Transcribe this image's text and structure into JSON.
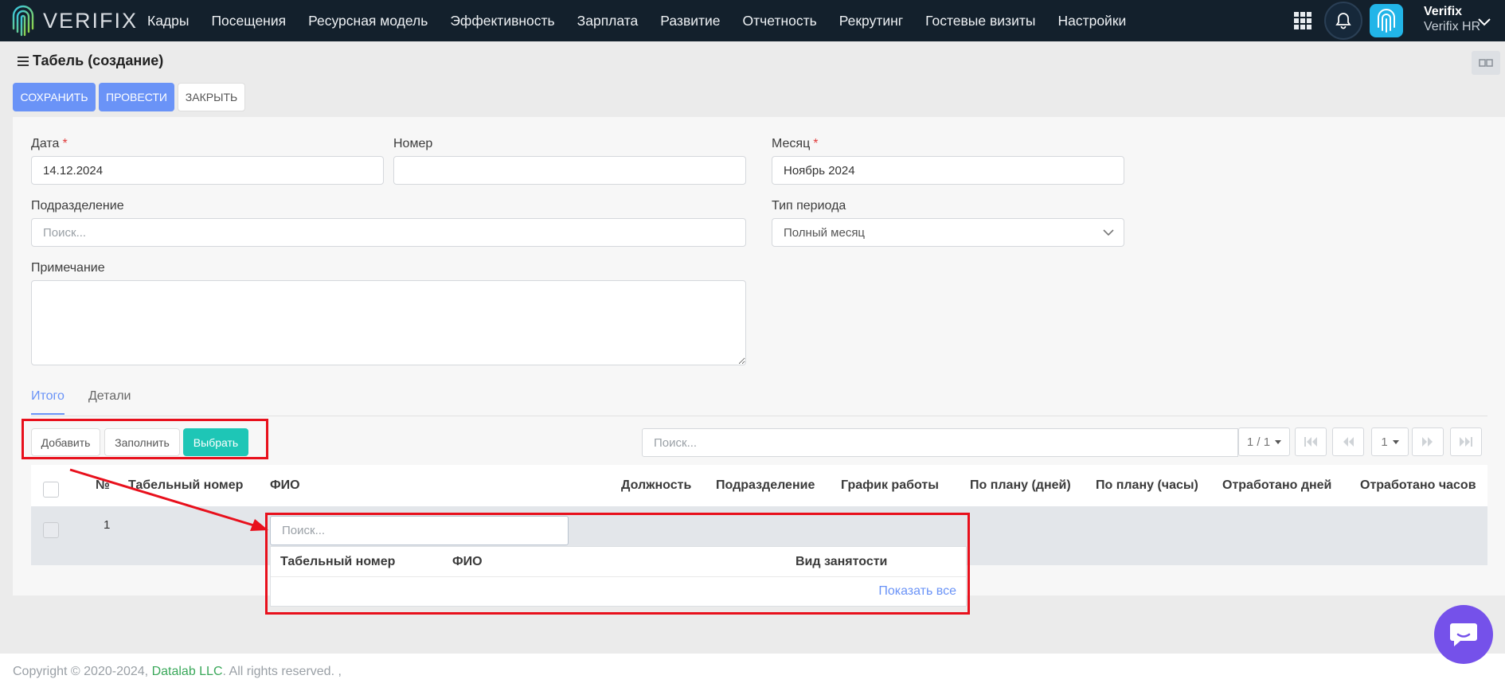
{
  "brand": {
    "name": "VERIFIX"
  },
  "nav": {
    "items": [
      "Кадры",
      "Посещения",
      "Ресурсная модель",
      "Эффективность",
      "Зарплата",
      "Развитие",
      "Отчетность",
      "Рекрутинг",
      "Гостевые визиты",
      "Настройки"
    ]
  },
  "user": {
    "name": "Verifix",
    "company": "Verifix HR"
  },
  "page": {
    "title": "Табель (создание)"
  },
  "toolbar": {
    "save": "СОХРАНИТЬ",
    "post": "ПРОВЕСТИ",
    "close": "ЗАКРЫТЬ"
  },
  "form": {
    "date_label": "Дата",
    "date_value": "14.12.2024",
    "number_label": "Номер",
    "number_value": "",
    "month_label": "Месяц",
    "month_value": "Ноябрь 2024",
    "required_mark": "*",
    "division_label": "Подразделение",
    "division_placeholder": "Поиск...",
    "period_type_label": "Тип периода",
    "period_type_value": "Полный месяц",
    "note_label": "Примечание",
    "note_value": ""
  },
  "tabs": [
    "Итого",
    "Детали"
  ],
  "actions": {
    "add": "Добавить",
    "fill": "Заполнить",
    "select": "Выбрать"
  },
  "table_search": {
    "placeholder": "Поиск..."
  },
  "pagination": {
    "pages": "1 / 1",
    "page_size": "1"
  },
  "table": {
    "columns": [
      "№",
      "Табельный номер",
      "ФИО",
      "Должность",
      "Подразделение",
      "График работы",
      "По плану (дней)",
      "По плану (часы)",
      "Отработано дней",
      "Отработано часов"
    ],
    "rows": [
      {
        "num": "1"
      }
    ]
  },
  "employee_dropdown": {
    "search_placeholder": "Поиск...",
    "columns": [
      "Табельный номер",
      "ФИО",
      "Вид занятости"
    ],
    "show_all": "Показать все"
  },
  "footer": {
    "prefix": "Copyright © 2020-2024, ",
    "company": "Datalab LLC",
    "suffix": ". All rights reserved. ,"
  },
  "colors": {
    "nav_bg": "#13202c",
    "primary": "#6a93f7",
    "teal": "#1ec6b6",
    "highlight": "#e8101c",
    "chat": "#7551ea",
    "link_green": "#3aa85a"
  }
}
